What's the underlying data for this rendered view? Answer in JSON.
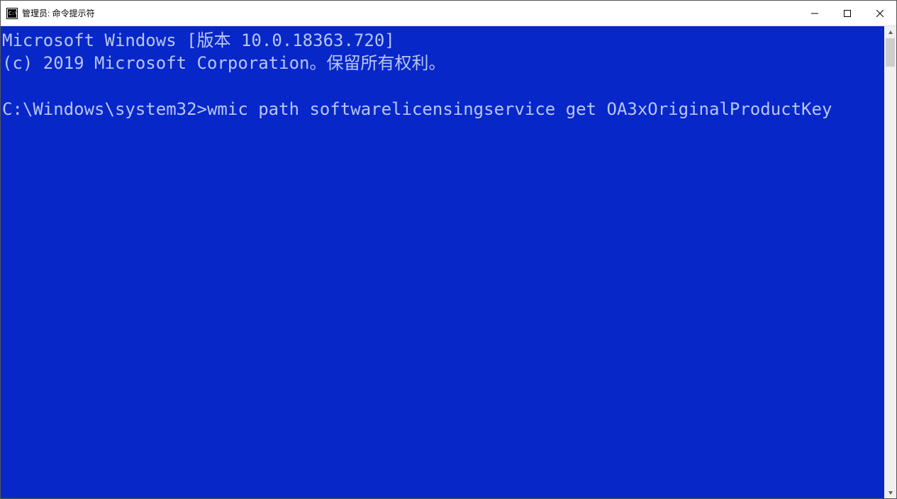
{
  "titlebar": {
    "title": "管理员: 命令提示符"
  },
  "terminal": {
    "line1": "Microsoft Windows [版本 10.0.18363.720]",
    "line2": "(c) 2019 Microsoft Corporation。保留所有权利。",
    "blank": "",
    "prompt": "C:\\Windows\\system32>",
    "command": "wmic path softwarelicensingservice get OA3xOriginalProductKey"
  }
}
